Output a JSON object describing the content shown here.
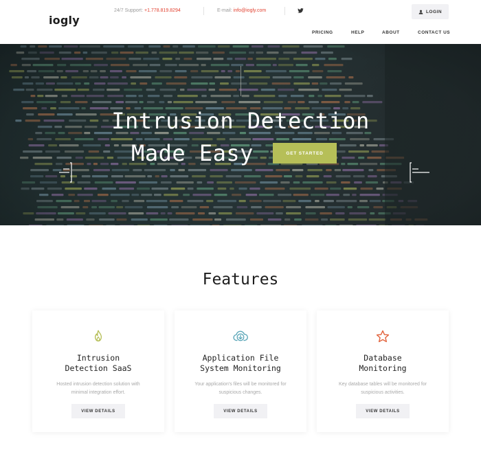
{
  "header": {
    "logo_main": "iogly",
    "support_label": "24/7 Support: ",
    "support_phone": "+1.778.819.8294",
    "email_label": "E-mail: ",
    "email_value": "info@iogly.com",
    "login_label": "LOGIN",
    "nav": [
      {
        "label": "PRICING"
      },
      {
        "label": "HELP"
      },
      {
        "label": "ABOUT"
      },
      {
        "label": "CONTACT US"
      }
    ]
  },
  "hero": {
    "title_line1": "Intrusion Detection",
    "title_line2": "Made Easy",
    "cta_label": "GET STARTED"
  },
  "features": {
    "title": "Features",
    "cards": [
      {
        "icon": "flame-icon",
        "icon_color": "#b6bf58",
        "title_line1": "Intrusion",
        "title_line2": "Detection SaaS",
        "desc_line1": "Hosted intrusion detection solution with",
        "desc_line2": "minimal integration effort.",
        "button_label": "VIEW DETAILS"
      },
      {
        "icon": "cloud-download-icon",
        "icon_color": "#5aa6b8",
        "title_line1": "Application File",
        "title_line2": "System Monitoring",
        "desc_line1": "Your application's files will be monitored for",
        "desc_line2": "suspicious changes.",
        "button_label": "VIEW DETAILS"
      },
      {
        "icon": "star-icon",
        "icon_color": "#e2613a",
        "title_line1": "Database",
        "title_line2": "Monitoring",
        "desc_line1": "Key database tables will be monitored for",
        "desc_line2": "suspicious activities.",
        "button_label": "VIEW DETAILS"
      }
    ]
  },
  "colors": {
    "accent_green": "#b6bf58",
    "accent_red": "#e2402f",
    "button_bg": "#f1f1f4"
  }
}
